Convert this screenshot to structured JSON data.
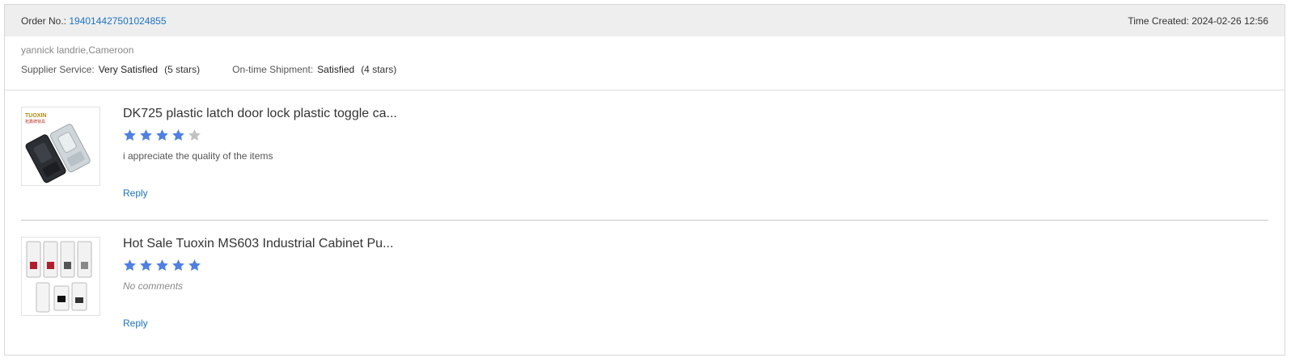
{
  "header": {
    "order_label": "Order No.:",
    "order_number": "194014427501024855",
    "time_label": "Time Created:",
    "time_value": "2024-02-26 12:56"
  },
  "buyer": {
    "name": "yannick landrie,Cameroon",
    "supplier_service_label": "Supplier Service:",
    "supplier_service_value": "Very Satisfied",
    "supplier_service_stars": "(5 stars)",
    "shipment_label": "On-time Shipment:",
    "shipment_value": "Satisfied",
    "shipment_stars": "(4 stars)"
  },
  "items": [
    {
      "title": "DK725 plastic latch door lock plastic toggle ca...",
      "rating": 4,
      "comment": "i appreciate the quality of the items",
      "reply_label": "Reply",
      "thumb_brand": "TUOXIN",
      "thumb_brand_sub": "拓鑫牌锁具"
    },
    {
      "title": "Hot Sale Tuoxin MS603 Industrial Cabinet Pu...",
      "rating": 5,
      "comment": "No comments",
      "reply_label": "Reply"
    }
  ],
  "colors": {
    "link": "#1a73c5",
    "star_filled": "#4d7fe8",
    "star_empty": "#c2c2c2",
    "header_bg": "#eeeeee"
  }
}
